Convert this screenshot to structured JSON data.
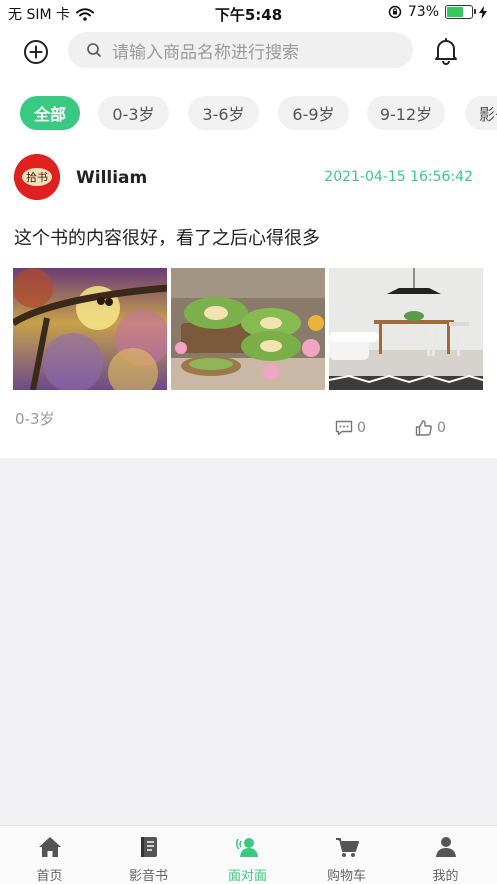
{
  "status_bar": {
    "carrier": "无 SIM 卡",
    "time": "下午5:48",
    "battery": "73%",
    "battery_level": 0.73
  },
  "header": {
    "search_placeholder": "请输入商品名称进行搜索"
  },
  "filters": [
    "全部",
    "0-3岁",
    "3-6岁",
    "6-9岁",
    "9-12岁",
    "影书"
  ],
  "active_filter": 0,
  "post": {
    "username": "William",
    "timestamp": "2021-04-15 16:56:42",
    "content": "这个书的内容很好，看了之后心得很多",
    "tag": "0-3岁",
    "comment_count": "0",
    "like_count": "0",
    "avatar_text": "拾书"
  },
  "tabs": [
    {
      "label": "首页",
      "icon": "home-icon"
    },
    {
      "label": "影音书",
      "icon": "book-icon"
    },
    {
      "label": "面对面",
      "icon": "face-to-face-icon"
    },
    {
      "label": "购物车",
      "icon": "cart-icon"
    },
    {
      "label": "我的",
      "icon": "profile-icon"
    }
  ],
  "active_tab": 2,
  "colors": {
    "accent": "#3ac982",
    "avatar_bg": "#e02020"
  }
}
